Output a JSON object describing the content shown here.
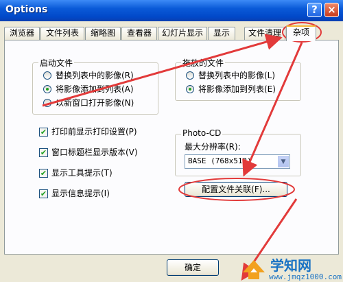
{
  "window": {
    "title": "Options",
    "help_label": "?",
    "close_label": "×"
  },
  "tabs": [
    "浏览器",
    "文件列表",
    "缩略图",
    "查看器",
    "幻灯片显示",
    "显示",
    "文件清理",
    "杂项"
  ],
  "active_tab": "杂项",
  "startup_group": {
    "title": "启动文件",
    "options": [
      {
        "label": "替换列表中的影像(R)",
        "checked": false
      },
      {
        "label": "将影像添加到列表(A)",
        "checked": true
      },
      {
        "label": "以新窗口打开影像(N)",
        "checked": false
      }
    ]
  },
  "drag_group": {
    "title": "拖放的文件",
    "options": [
      {
        "label": "替换列表中的影像(L)",
        "checked": false
      },
      {
        "label": "将影像添加到列表(E)",
        "checked": true
      }
    ]
  },
  "checkboxes": [
    {
      "label": "打印前显示打印设置(P)",
      "checked": true
    },
    {
      "label": "窗口标题栏显示版本(V)",
      "checked": true
    },
    {
      "label": "显示工具提示(T)",
      "checked": true
    },
    {
      "label": "显示信息提示(I)",
      "checked": true
    }
  ],
  "photocd_group": {
    "title": "Photo-CD",
    "resolution_label": "最大分辨率(R):",
    "resolution_value": "BASE (768x512)"
  },
  "associate_button": "配置文件关联(F)...",
  "ok_button": "确定",
  "watermark": {
    "text": "学知网",
    "url": "www.jmqz1000.com"
  },
  "annotation_color": "#e23a3a"
}
